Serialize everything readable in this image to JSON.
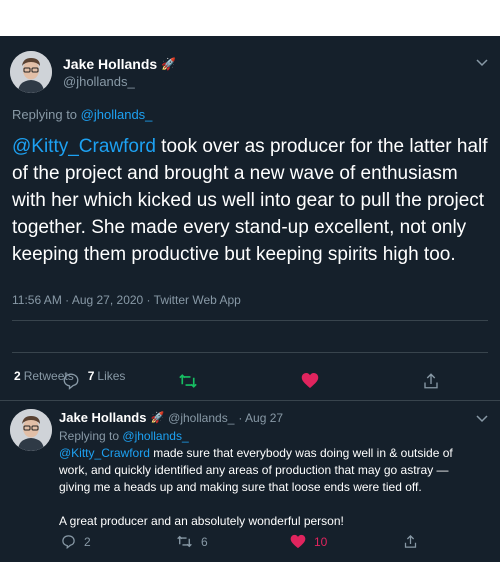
{
  "main_tweet": {
    "author_name": "Jake Hollands",
    "author_emoji": "🚀",
    "handle": "@jhollands_",
    "replying_prefix": "Replying to",
    "replying_to": "@jhollands_",
    "mention": "@Kitty_Crawford",
    "text": " took over as producer for the latter half of the project and brought a new wave of enthusiasm with her which kicked us well into gear to pull the project together. She made every stand-up excellent, not only keeping them productive but keeping spirits high too.",
    "timestamp": "11:56 AM · Aug 27, 2020 · Twitter Web App",
    "retweets_count": "2",
    "retweets_label": "Retweets",
    "likes_count": "7",
    "likes_label": "Likes"
  },
  "reply_tweet": {
    "author_name": "Jake Hollands",
    "author_emoji": "🚀",
    "handle": "@jhollands_",
    "date": "· Aug 27",
    "replying_prefix": "Replying to",
    "replying_to": "@jhollands_",
    "mention": "@Kitty_Crawford",
    "text_para1": " made sure that everybody was doing well in & outside of work, and quickly identified any areas of production that may go astray — giving me a heads up and making sure that loose ends were tied off.",
    "text_para2": "A great producer and an absolutely wonderful person!",
    "reply_count": "2",
    "retweet_count": "6",
    "like_count": "10"
  },
  "colors": {
    "background": "#15202b",
    "link": "#1da1f2",
    "retweet_green": "#17bf63",
    "like_pink": "#e0245e",
    "muted": "#8899a6"
  }
}
